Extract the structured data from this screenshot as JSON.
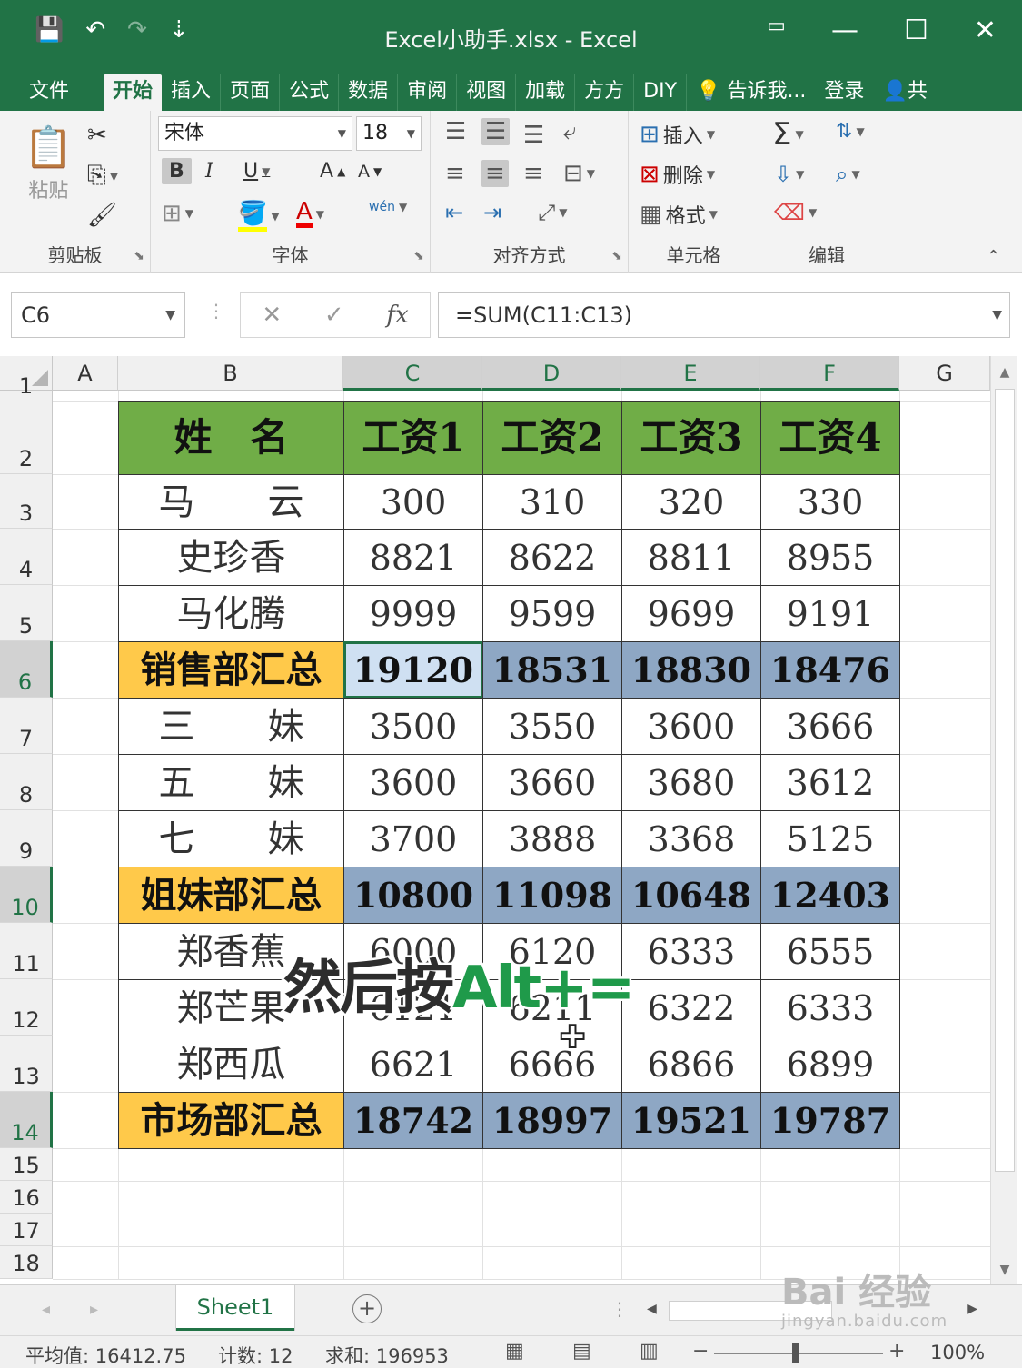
{
  "window": {
    "title": "Excel小助手.xlsx - Excel",
    "controls": [
      "▭",
      "—",
      "☐",
      "✕"
    ]
  },
  "quick_access": [
    "💾",
    "↶",
    "↷",
    "⇣"
  ],
  "tabs": [
    {
      "label": "文件",
      "active": false
    },
    {
      "label": "开始",
      "active": true
    },
    {
      "label": "插入",
      "active": false
    },
    {
      "label": "页面",
      "active": false
    },
    {
      "label": "公式",
      "active": false
    },
    {
      "label": "数据",
      "active": false
    },
    {
      "label": "审阅",
      "active": false
    },
    {
      "label": "视图",
      "active": false
    },
    {
      "label": "加载",
      "active": false
    },
    {
      "label": "方方",
      "active": false
    },
    {
      "label": "DIY",
      "active": false
    },
    {
      "label": "告诉我...",
      "active": false
    },
    {
      "label": "登录",
      "active": false
    },
    {
      "label": "共",
      "active": false
    }
  ],
  "ribbon": {
    "clipboard": {
      "label": "剪贴板",
      "paste": "粘贴"
    },
    "font": {
      "label": "字体",
      "font_name": "宋体",
      "font_size": "18",
      "bold": "B",
      "italic": "I",
      "underline": "U",
      "grow": "A",
      "shrink": "A",
      "phonetic": "wén"
    },
    "alignment": {
      "label": "对齐方式"
    },
    "cells": {
      "label": "单元格",
      "insert": "插入",
      "delete": "删除",
      "format": "格式"
    },
    "editing": {
      "label": "编辑",
      "sum": "Σ"
    }
  },
  "formula_bar": {
    "name_box": "C6",
    "cancel": "✕",
    "enter": "✓",
    "fx": "fx",
    "formula": "=SUM(C11:C13)"
  },
  "columns": [
    "A",
    "B",
    "C",
    "D",
    "E",
    "F",
    "G"
  ],
  "rows": [
    "1",
    "2",
    "3",
    "4",
    "5",
    "6",
    "7",
    "8",
    "9",
    "10",
    "11",
    "12",
    "13",
    "14",
    "15",
    "16",
    "17",
    "18"
  ],
  "table": {
    "headers": [
      "姓　名",
      "工资1",
      "工资2",
      "工资3",
      "工资4"
    ],
    "rows": [
      {
        "type": "data",
        "name": "马　　云",
        "values": [
          "300",
          "310",
          "320",
          "330"
        ]
      },
      {
        "type": "data",
        "name": "史珍香",
        "values": [
          "8821",
          "8622",
          "8811",
          "8955"
        ]
      },
      {
        "type": "data",
        "name": "马化腾",
        "values": [
          "9999",
          "9599",
          "9699",
          "9191"
        ]
      },
      {
        "type": "sum",
        "name": "销售部汇总",
        "values": [
          "19120",
          "18531",
          "18830",
          "18476"
        ]
      },
      {
        "type": "data",
        "name": "三　　妹",
        "values": [
          "3500",
          "3550",
          "3600",
          "3666"
        ]
      },
      {
        "type": "data",
        "name": "五　　妹",
        "values": [
          "3600",
          "3660",
          "3680",
          "3612"
        ]
      },
      {
        "type": "data",
        "name": "七　　妹",
        "values": [
          "3700",
          "3888",
          "3368",
          "5125"
        ]
      },
      {
        "type": "sum",
        "name": "姐妹部汇总",
        "values": [
          "10800",
          "11098",
          "10648",
          "12403"
        ]
      },
      {
        "type": "data",
        "name": "郑香蕉",
        "values": [
          "6000",
          "6120",
          "6333",
          "6555"
        ]
      },
      {
        "type": "data",
        "name": "郑芒果",
        "values": [
          "6121",
          "6211",
          "6322",
          "6333"
        ]
      },
      {
        "type": "data",
        "name": "郑西瓜",
        "values": [
          "6621",
          "6666",
          "6866",
          "6899"
        ]
      },
      {
        "type": "sum",
        "name": "市场部汇总",
        "values": [
          "18742",
          "18997",
          "19521",
          "19787"
        ]
      }
    ]
  },
  "overlay_caption": {
    "part1": "然后按",
    "part2": "Alt+="
  },
  "sheet_tabs": [
    "Sheet1"
  ],
  "status": {
    "average": "平均值: 16412.75",
    "count": "计数: 12",
    "sum": "求和: 196953",
    "zoom": "100%"
  },
  "watermark": {
    "main": "Bai 经验",
    "sub": "jingyan.baidu.com"
  }
}
